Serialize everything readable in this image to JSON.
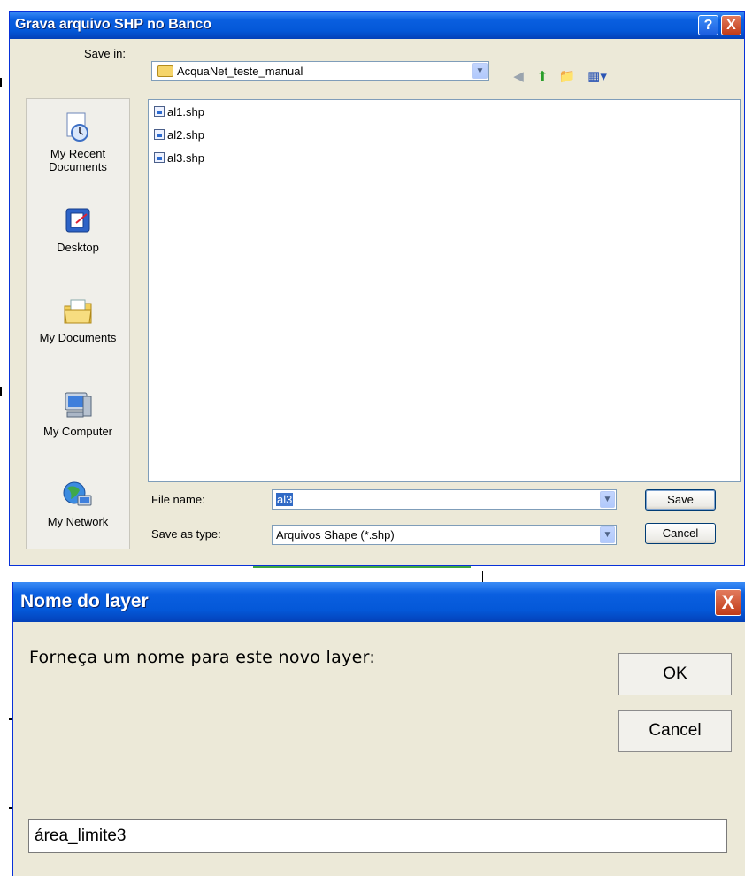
{
  "save_dialog": {
    "title": "Grava arquivo SHP no Banco",
    "help_button": "?",
    "close_button": "X",
    "save_in_label": "Save in:",
    "save_in_value": "AcquaNet_teste_manual",
    "places": [
      {
        "label": "My Recent Documents",
        "icon": "recent-documents-icon"
      },
      {
        "label": "Desktop",
        "icon": "desktop-icon"
      },
      {
        "label": "My Documents",
        "icon": "my-documents-icon"
      },
      {
        "label": "My Computer",
        "icon": "my-computer-icon"
      },
      {
        "label": "My Network",
        "icon": "my-network-icon"
      }
    ],
    "files": [
      "al1.shp",
      "al2.shp",
      "al3.shp"
    ],
    "file_name_label": "File name:",
    "file_name_value": "al3",
    "save_as_type_label": "Save as type:",
    "save_as_type_value": "Arquivos Shape (*.shp)",
    "save_button": "Save",
    "cancel_button": "Cancel"
  },
  "layer_dialog": {
    "title": "Nome do layer",
    "close_button": "X",
    "prompt": "Forneça um nome para este novo layer:",
    "ok_button": "OK",
    "cancel_button": "Cancel",
    "input_value": "área_limite3"
  },
  "colors": {
    "titlebar": "#0458d8",
    "dialog_bg": "#ece9d8",
    "selection": "#316ac5"
  }
}
